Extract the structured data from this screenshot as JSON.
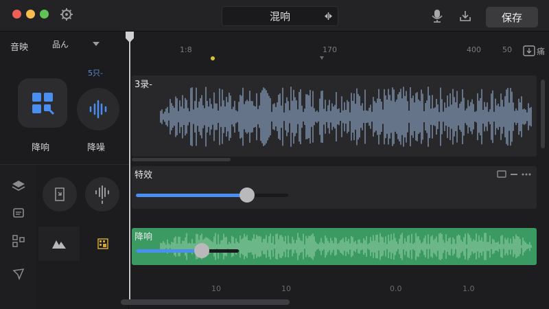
{
  "titlebar": {
    "title": "混响",
    "save_label": "保存",
    "icons": [
      "gear-icon",
      "swap-icon",
      "mic-icon",
      "download-icon"
    ]
  },
  "sidebar": {
    "track_label": "音映",
    "select_value": "品ん",
    "count_label": "5只-",
    "denoise_label": "降响",
    "noise_reduce_label": "降噪",
    "rail_icons": [
      "layers-icon",
      "message-icon",
      "grid-icon",
      "pen-icon"
    ],
    "tool_icons": [
      "mountain-icon",
      "table-icon",
      "frame-icon",
      "waveform-icon"
    ]
  },
  "timeline": {
    "ruler": [
      "1:8",
      "170",
      "400",
      "50"
    ],
    "export_label": "痛",
    "bottom_ruler": [
      "10",
      "10",
      "0.0",
      "1.0"
    ]
  },
  "tracks": {
    "main": {
      "title": "3录-"
    },
    "fx": {
      "title": "特效",
      "slider_value": 0.73
    },
    "nr": {
      "title": "降响",
      "slider_value": 0.64
    }
  },
  "colors": {
    "accent": "#4a8ef0",
    "waveform": "#8ea6c8",
    "noise_track": "#3a9a62",
    "noise_wave": "#8ccaa0"
  }
}
